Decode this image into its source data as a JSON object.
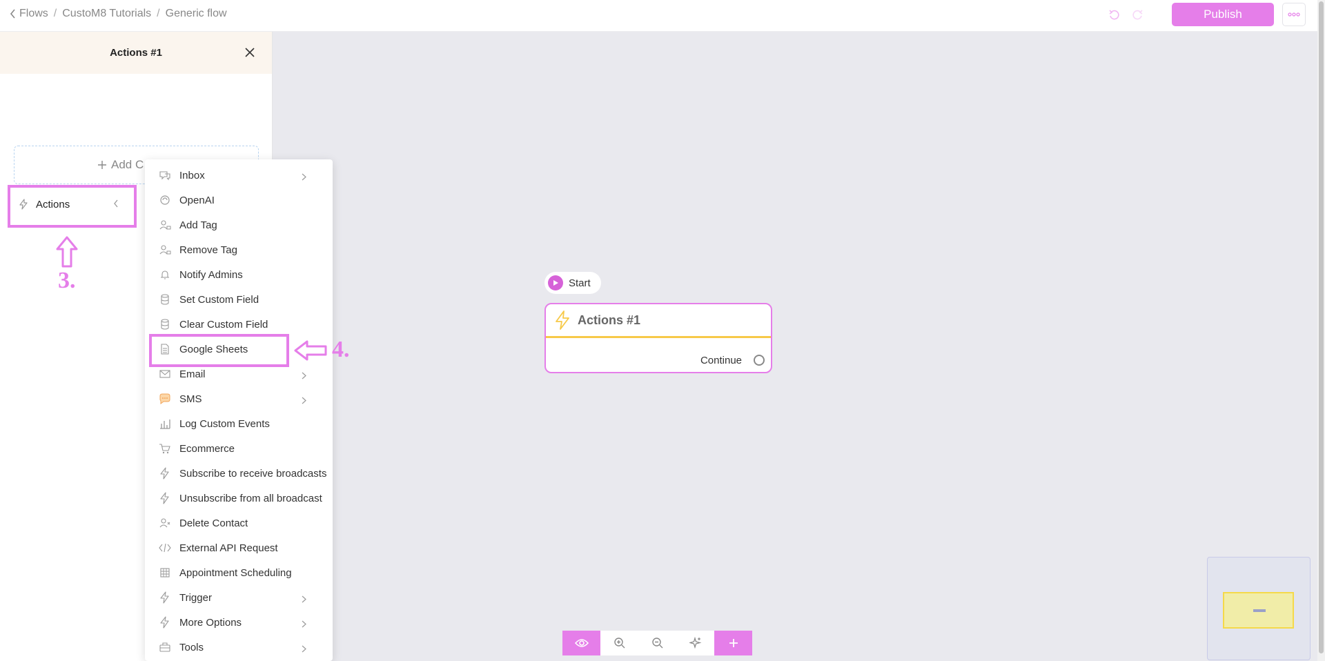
{
  "breadcrumb": {
    "items": [
      "Flows",
      "CustoM8 Tutorials",
      "Generic flow"
    ]
  },
  "header": {
    "publish_label": "Publish"
  },
  "panel": {
    "title": "Actions #1",
    "add_label": "Add C",
    "actions_item_label": "Actions"
  },
  "annotations": {
    "step3": "3.",
    "step4": "4."
  },
  "menu": {
    "items": [
      {
        "label": "Inbox",
        "icon": "inbox-icon",
        "submenu": true
      },
      {
        "label": "OpenAI",
        "icon": "openai-icon",
        "submenu": false
      },
      {
        "label": "Add Tag",
        "icon": "user-tag-icon",
        "submenu": false
      },
      {
        "label": "Remove Tag",
        "icon": "user-tag-icon",
        "submenu": false
      },
      {
        "label": "Notify Admins",
        "icon": "bell-icon",
        "submenu": false
      },
      {
        "label": "Set Custom Field",
        "icon": "database-icon",
        "submenu": false
      },
      {
        "label": "Clear Custom Field",
        "icon": "database-icon",
        "submenu": false
      },
      {
        "label": "Google Sheets",
        "icon": "sheet-icon",
        "submenu": false
      },
      {
        "label": "Email",
        "icon": "mail-icon",
        "submenu": true
      },
      {
        "label": "SMS",
        "icon": "sms-icon",
        "submenu": true
      },
      {
        "label": "Log Custom Events",
        "icon": "chart-icon",
        "submenu": false
      },
      {
        "label": "Ecommerce",
        "icon": "cart-icon",
        "submenu": false
      },
      {
        "label": "Subscribe to receive broadcasts",
        "icon": "bolt-icon",
        "submenu": false
      },
      {
        "label": "Unsubscribe from all broadcast",
        "icon": "bolt-icon",
        "submenu": false
      },
      {
        "label": "Delete Contact",
        "icon": "user-delete-icon",
        "submenu": false
      },
      {
        "label": "External API Request",
        "icon": "code-icon",
        "submenu": false
      },
      {
        "label": "Appointment Scheduling",
        "icon": "calendar-icon",
        "submenu": false
      },
      {
        "label": "Trigger",
        "icon": "bolt-icon",
        "submenu": true
      },
      {
        "label": "More Options",
        "icon": "bolt-icon",
        "submenu": true
      },
      {
        "label": "Tools",
        "icon": "toolbox-icon",
        "submenu": true
      }
    ]
  },
  "flow": {
    "start_label": "Start",
    "node_title": "Actions #1",
    "node_output_label": "Continue"
  },
  "colors": {
    "accent": "#e57ee9",
    "node_divider": "#f7c948",
    "canvas": "#e9e9ee"
  }
}
